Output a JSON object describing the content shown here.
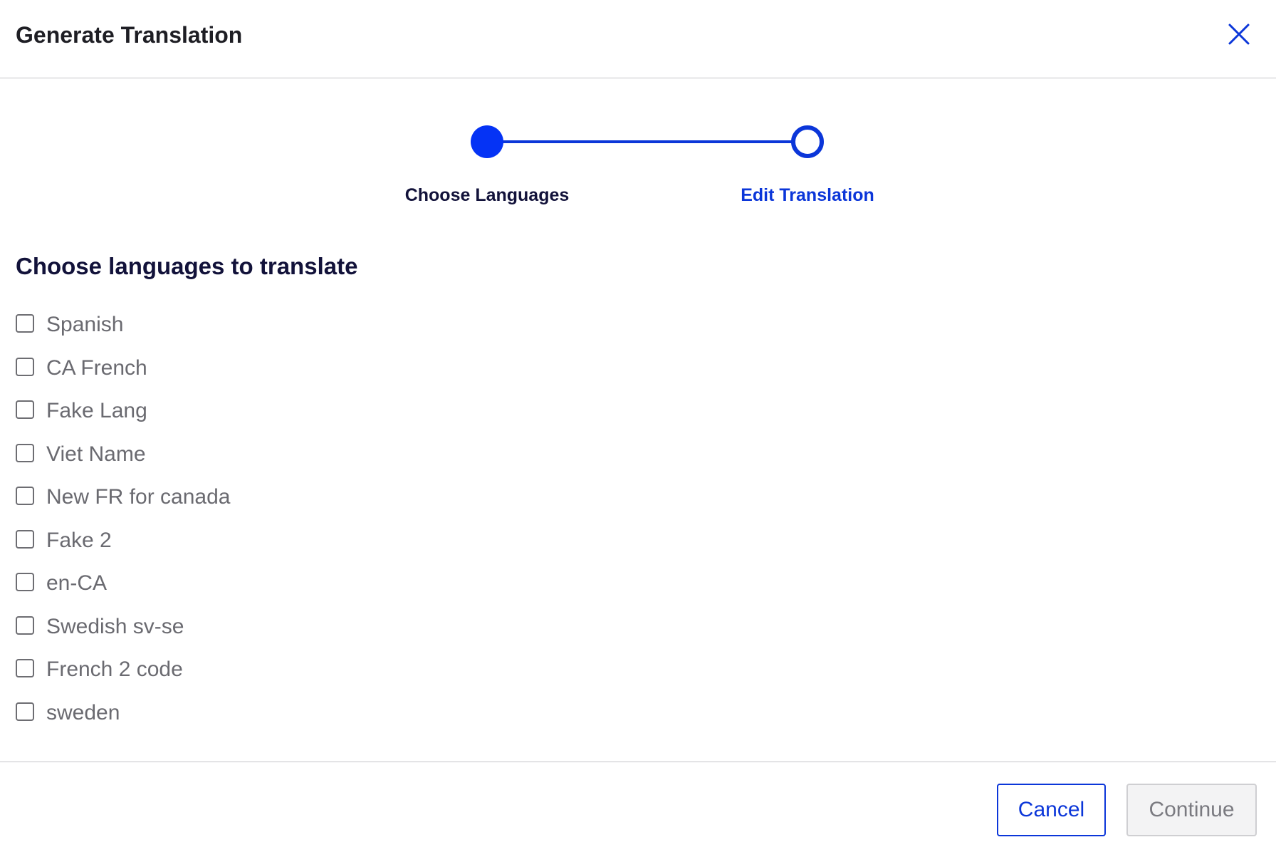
{
  "dialog": {
    "title": "Generate Translation",
    "close_icon": "close-icon"
  },
  "stepper": {
    "steps": [
      {
        "label": "Choose Languages",
        "state": "complete"
      },
      {
        "label": "Edit Translation",
        "state": "current"
      }
    ],
    "accent_color": "#0b36d9"
  },
  "main": {
    "heading": "Choose languages to translate",
    "languages": [
      {
        "label": "Spanish",
        "checked": false
      },
      {
        "label": "CA French",
        "checked": false
      },
      {
        "label": "Fake Lang",
        "checked": false
      },
      {
        "label": "Viet Name",
        "checked": false
      },
      {
        "label": "New FR for canada",
        "checked": false
      },
      {
        "label": "Fake 2",
        "checked": false
      },
      {
        "label": "en-CA",
        "checked": false
      },
      {
        "label": "Swedish sv-se",
        "checked": false
      },
      {
        "label": "French 2 code",
        "checked": false
      },
      {
        "label": "sweden",
        "checked": false
      }
    ]
  },
  "footer": {
    "cancel_label": "Cancel",
    "continue_label": "Continue"
  }
}
